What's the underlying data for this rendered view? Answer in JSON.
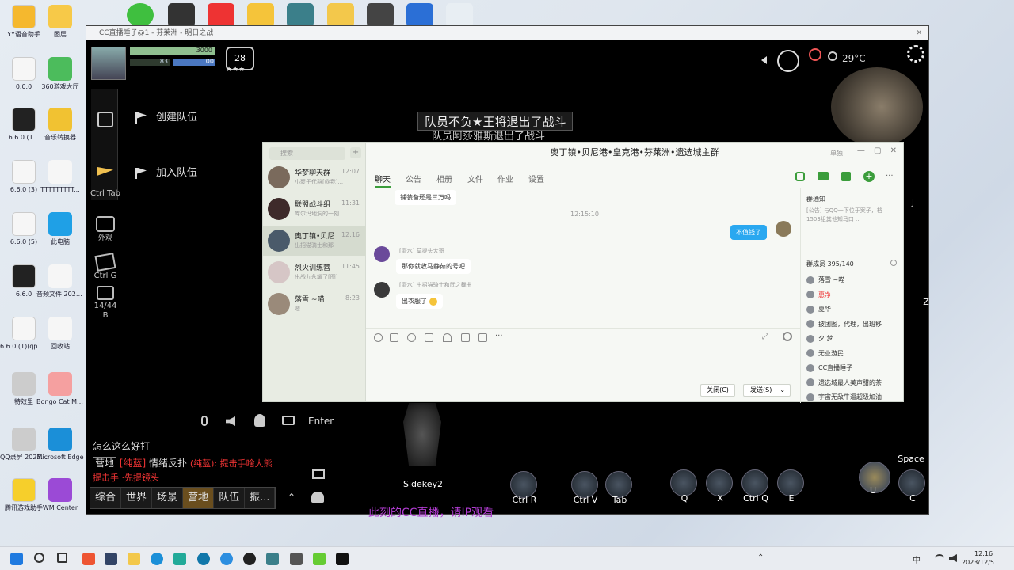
{
  "desktop": {
    "icons": [
      {
        "label": "YY语音助手",
        "color": "#f5b82e"
      },
      {
        "label": "0.0.0",
        "color": "#f6f6f6"
      },
      {
        "label": "6.6.0 (1...",
        "color": "#222222"
      },
      {
        "label": "6.6.0 (3)",
        "color": "#f6f6f6"
      },
      {
        "label": "6.6.0 (5)",
        "color": "#f6f6f6"
      },
      {
        "label": "6.6.0",
        "color": "#222222"
      },
      {
        "label": "6.6.0 (1)(qpuvu...",
        "color": "#f6f6f6"
      },
      {
        "label": "特效里",
        "color": "#cccccc"
      },
      {
        "label": "QQ录屏 2023116...",
        "color": "#cccccc"
      },
      {
        "label": "腾讯游戏助手",
        "color": "#f6cf2b"
      }
    ],
    "icons_col2": [
      {
        "label": "图层",
        "color": "#f7c948"
      },
      {
        "label": "360游戏大厅",
        "color": "#4cbc5c"
      },
      {
        "label": "音乐转换器",
        "color": "#f1c232"
      },
      {
        "label": "TTTTTTTTT...",
        "color": "#f6f6f6"
      },
      {
        "label": "此电脑",
        "color": "#1fa0e6"
      },
      {
        "label": "音频文件 2023.12...",
        "color": "#f6f6f6"
      },
      {
        "label": "回收站",
        "color": "#f6f6f6"
      },
      {
        "label": "Bongo Cat Mver - 快...",
        "color": "#f5a0a0"
      },
      {
        "label": "Microsoft Edge",
        "color": "#1b8fd8"
      },
      {
        "label": "WM Center",
        "color": "#9b4ad6"
      }
    ]
  },
  "game": {
    "window_title": "CC直播睡子@1 - 芬莱洲 - 明日之战",
    "hp_text": "3000",
    "mp_text": "83",
    "exp_text": "100",
    "level": "28",
    "menu_create_team": "创建队伍",
    "menu_join_team": "加入队伍",
    "hotkey_tab": "Ctrl Tab",
    "hotkey_appearance": "外观",
    "hotkey_g": "Ctrl G",
    "inventory_count": "14/44",
    "inventory_key": "B",
    "announce_1": "队员不负★王将退出了战斗",
    "announce_2": "队员阿莎雅斯退出了战斗",
    "temperature": "29°C",
    "chat_enter": "Enter",
    "chat_line_1": "怎么这么好打",
    "chat_channel_camp": "营地",
    "chat_line_2_name": "[纯蓝]",
    "chat_line_2_text": "情绪反扑",
    "chat_line_2_extra": "(纯蓝): 提击手啥大熊",
    "chat_line_3": "提击手 ·先提镜头",
    "chat_tabs": [
      "综合",
      "世界",
      "场景",
      "营地",
      "队伍",
      "振..."
    ],
    "chat_tab_active": "营地",
    "subtitle": "此刻的CC直播，请IP观看",
    "skills": [
      {
        "label": "Sidekey2"
      },
      {
        "label": "Ctrl R"
      },
      {
        "label": "Ctrl V"
      },
      {
        "label": "Tab"
      },
      {
        "label": "Q"
      },
      {
        "label": "X"
      },
      {
        "label": "Ctrl Q"
      },
      {
        "label": "E"
      },
      {
        "label": "U"
      },
      {
        "label": "C"
      },
      {
        "label": "Space"
      },
      {
        "label": "Z"
      }
    ],
    "minimap_side": "J"
  },
  "qq": {
    "title": "奥丁镇•贝尼港•皇克港•芬莱洲•遗选城主群",
    "search_placeholder": "搜索",
    "conversations": [
      {
        "name": "华梦聊天群",
        "time": "12:07",
        "preview": "小聚子代群[@我]...",
        "color": "#7a6a5c"
      },
      {
        "name": "联盟战斗组",
        "time": "11:31",
        "preview": "库尔玛地洞的一刻",
        "color": "#3e2a2a"
      },
      {
        "name": "奥丁镇•贝尼",
        "time": "12:16",
        "preview": "出招猫骑士和那",
        "color": "#4a5a6a"
      },
      {
        "name": "烈火训练营",
        "time": "11:45",
        "preview": "出战九永耀了[图]",
        "color": "#d6c6c6"
      },
      {
        "name": "落雪 ~喵",
        "time": "8:23",
        "preview": "嗯",
        "color": "#9a8a7a"
      }
    ],
    "tabs": [
      "聊天",
      "公告",
      "相册",
      "文件",
      "作业",
      "设置"
    ],
    "tab_active": "聊天",
    "messages": [
      {
        "type": "in",
        "text": "铺装备还是三万吗"
      },
      {
        "type": "time",
        "text": "12:15:10"
      },
      {
        "type": "out",
        "text": "不值钱了"
      },
      {
        "type": "in",
        "sender": "[潜水] 莫提头大哥",
        "text": "那你就收马静茹的号吧"
      },
      {
        "type": "in",
        "sender": "[潜水] 出招猫骑士和武之舞曲",
        "text": "出衣服了"
      }
    ],
    "notice_title": "群通知",
    "notice_text": "[公告] 与QQ一下位于案子，档1503组其他知马口 ...",
    "members_title": "群成员 395/140",
    "members": [
      "落雪 ~喵",
      "惠净",
      "夏华",
      "披团图，代理，出班移",
      "夕 梦",
      "无业游民",
      "CC直播睡子",
      "遗选城最人美声甜的茶",
      "宇宙无敌牛逼超级加油"
    ],
    "close_btn": "关闭(C)",
    "send_btn": "发送(S)",
    "window_mode": "单独"
  },
  "taskbar": {
    "time": "12:16",
    "date": "2023/12/5",
    "ime": "中"
  }
}
